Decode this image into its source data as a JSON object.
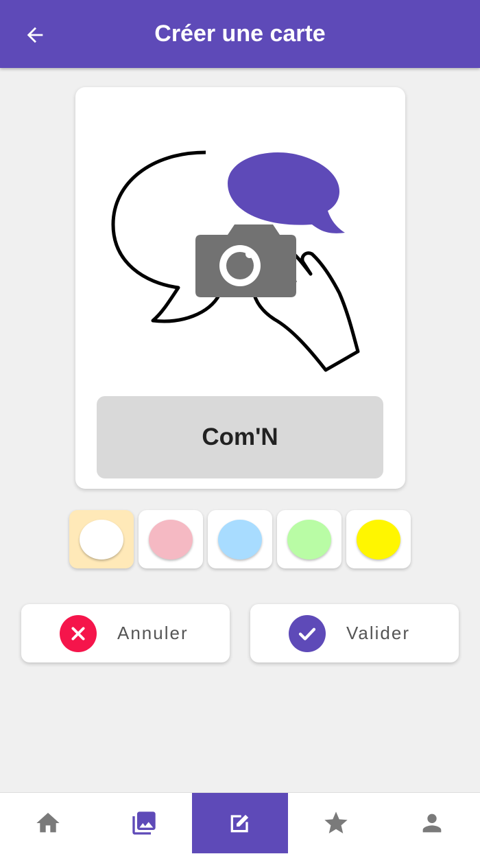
{
  "header": {
    "title": "Créer une carte",
    "back_icon": "arrow-back-icon"
  },
  "card": {
    "label": "Com'N",
    "image": "speech-bubbles-camera-hand-illustration"
  },
  "colors": {
    "accent": "#5e4ab8",
    "cancel": "#f5154b",
    "swatches": [
      "#ffffff",
      "#f5b9c3",
      "#a8dcff",
      "#b9fca5",
      "#fff600"
    ],
    "selected_swatch_index": 0
  },
  "actions": {
    "cancel_label": "Annuler",
    "confirm_label": "Valider"
  },
  "nav": {
    "items": [
      {
        "icon": "home-icon"
      },
      {
        "icon": "photo-library-icon"
      },
      {
        "icon": "edit-icon",
        "active": true
      },
      {
        "icon": "star-icon"
      },
      {
        "icon": "person-icon"
      }
    ]
  }
}
